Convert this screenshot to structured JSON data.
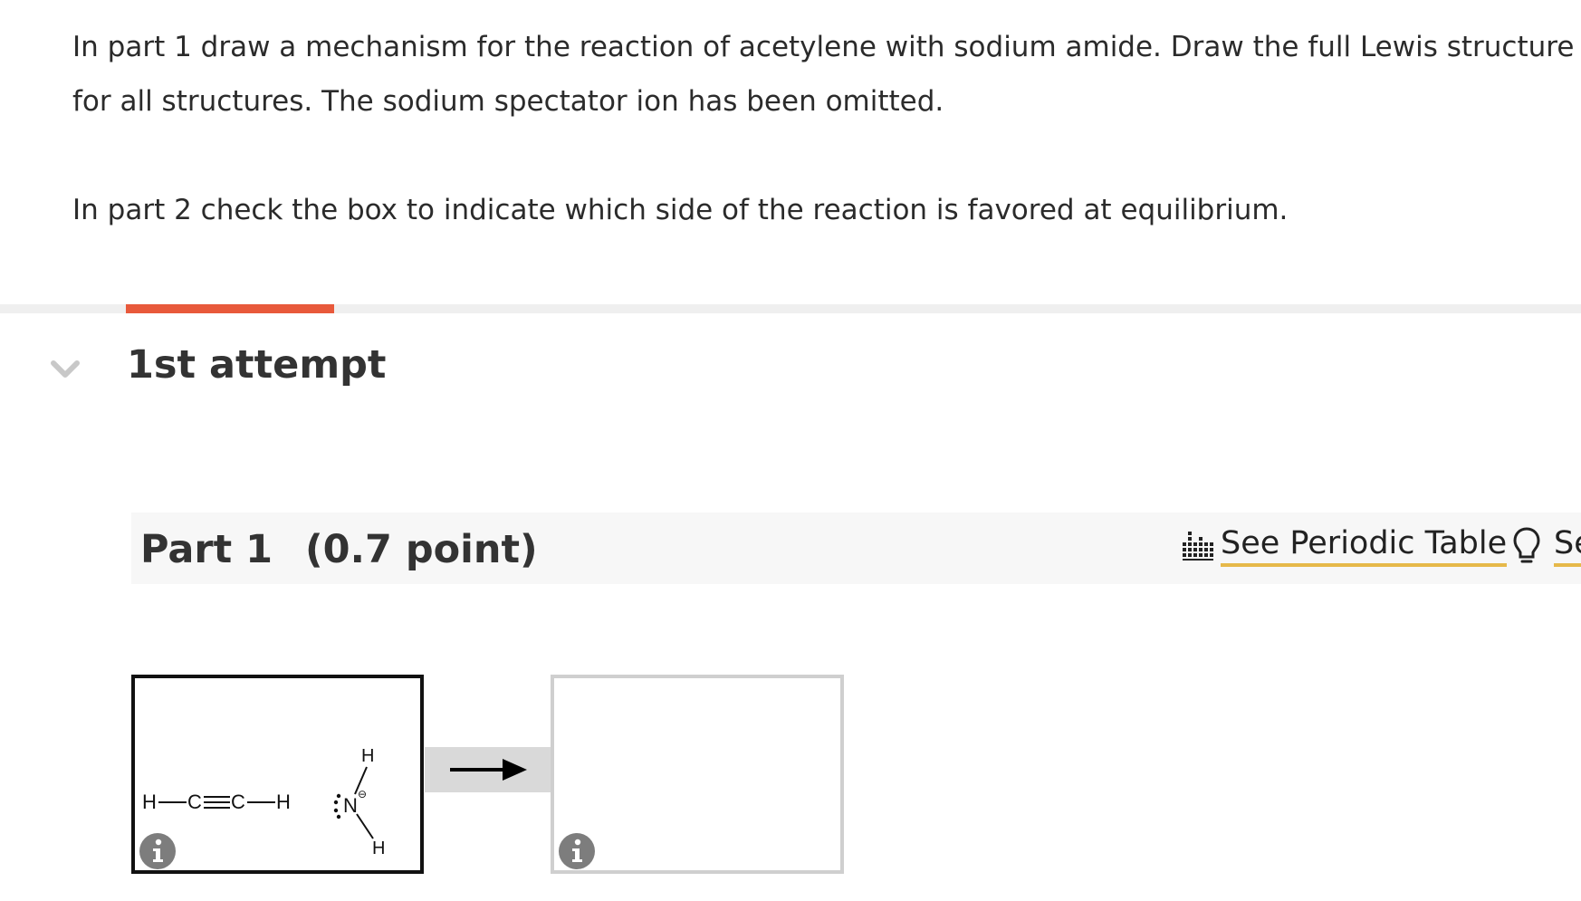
{
  "instructions": {
    "line1": "In part 1 draw a mechanism for the reaction of acetylene with sodium amide. Draw the full Lewis structure for all structures. The sodium spectator ion has been omitted.",
    "line2": "In part 2 check the box to indicate which side of the reaction is favored at equilibrium."
  },
  "attempt": {
    "title": "1st attempt",
    "indicator_color": "#e8593b",
    "chevron_icon": "chevron-down-icon"
  },
  "part": {
    "label": "Part 1",
    "points": "(0.7 point)"
  },
  "toolbar": {
    "periodic_table_label": "See Periodic Table",
    "periodic_table_icon": "periodic-table-icon",
    "hint_label": "See Hint",
    "hint_icon": "lightbulb-icon",
    "link_underline_color": "#e6b94a"
  },
  "reaction": {
    "reactant": {
      "acetylene": {
        "h_left": "H",
        "c_left": "C",
        "c_right": "C",
        "h_right": "H"
      },
      "amide": {
        "nitrogen": "N",
        "h_top": "H",
        "h_bottom": "H",
        "charge": "⊖"
      }
    },
    "arrow_icon": "reaction-arrow-icon",
    "info_icon": "info-icon"
  }
}
